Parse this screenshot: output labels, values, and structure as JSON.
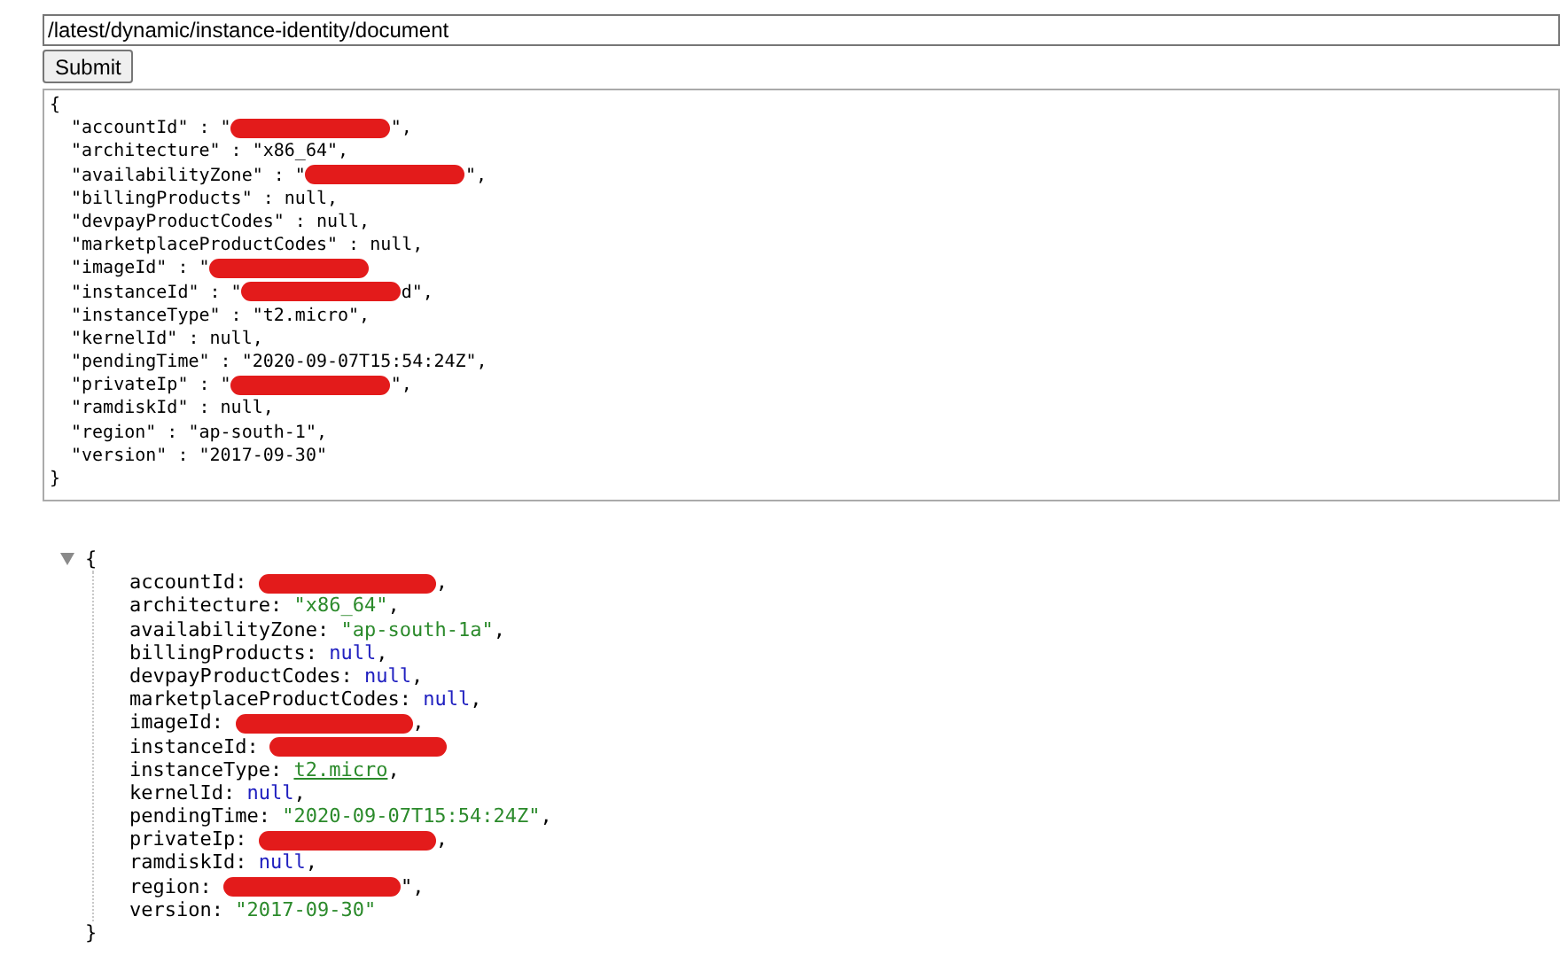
{
  "url_field": {
    "value": "/latest/dynamic/instance-identity/document"
  },
  "submit_button": {
    "label": "Submit"
  },
  "raw_output": {
    "open": "{",
    "close": "}",
    "lines": [
      {
        "before": "\"accountId\" : \"",
        "redacted": true,
        "after": "\","
      },
      {
        "before": "\"architecture\" : \"x86_64\",",
        "redacted": false
      },
      {
        "before": "\"availabilityZone\" : \"",
        "redacted": true,
        "after": "\","
      },
      {
        "before": "\"billingProducts\" : null,",
        "redacted": false
      },
      {
        "before": "\"devpayProductCodes\" : null,",
        "redacted": false
      },
      {
        "before": "\"marketplaceProductCodes\" : null,",
        "redacted": false
      },
      {
        "before": "\"imageId\" : \"",
        "redacted": true
      },
      {
        "before": "\"instanceId\" : \"",
        "redacted": true,
        "after": "d\","
      },
      {
        "before": "\"instanceType\" : \"t2.micro\",",
        "redacted": false
      },
      {
        "before": "\"kernelId\" : null,",
        "redacted": false
      },
      {
        "before": "\"pendingTime\" : \"2020-09-07T15:54:24Z\",",
        "redacted": false
      },
      {
        "before": "\"privateIp\" : \"",
        "redacted": true,
        "after": "\","
      },
      {
        "before": "\"ramdiskId\" : null,",
        "redacted": false
      },
      {
        "before": "\"region\" : \"ap-south-1\",",
        "redacted": false
      },
      {
        "before": "\"version\" : \"2017-09-30\"",
        "redacted": false
      }
    ]
  },
  "json_viewer": {
    "expanded": true,
    "open": "{",
    "close": "}",
    "entries": [
      {
        "key": "accountId:",
        "redacted": true,
        "after": ","
      },
      {
        "key": "architecture:",
        "kind": "string",
        "value": "\"x86_64\"",
        "redacted": false,
        "after": ","
      },
      {
        "key": "availabilityZone:",
        "kind": "string",
        "value": "\"ap-south-1a\"",
        "redacted": false,
        "after": ","
      },
      {
        "key": "billingProducts:",
        "kind": "null",
        "value": "null",
        "redacted": false,
        "after": ","
      },
      {
        "key": "devpayProductCodes:",
        "kind": "null",
        "value": "null",
        "redacted": false,
        "after": ","
      },
      {
        "key": "marketplaceProductCodes:",
        "kind": "null",
        "value": "null",
        "redacted": false,
        "after": ","
      },
      {
        "key": "imageId:",
        "redacted": true,
        "after": ","
      },
      {
        "key": "instanceId:",
        "redacted": true
      },
      {
        "key": "instanceType:",
        "kind": "link",
        "value": "t2.micro",
        "redacted": false,
        "after": ","
      },
      {
        "key": "kernelId:",
        "kind": "null",
        "value": "null",
        "redacted": false,
        "after": ","
      },
      {
        "key": "pendingTime:",
        "kind": "string",
        "value": "\"2020-09-07T15:54:24Z\"",
        "redacted": false,
        "after": ","
      },
      {
        "key": "privateIp:",
        "redacted": true,
        "after": ","
      },
      {
        "key": "ramdiskId:",
        "kind": "null",
        "value": "null",
        "redacted": false,
        "after": ","
      },
      {
        "key": "region:",
        "redacted": true,
        "after": "\","
      },
      {
        "key": "version:",
        "kind": "string",
        "value": "\"2017-09-30\"",
        "redacted": false
      }
    ]
  }
}
